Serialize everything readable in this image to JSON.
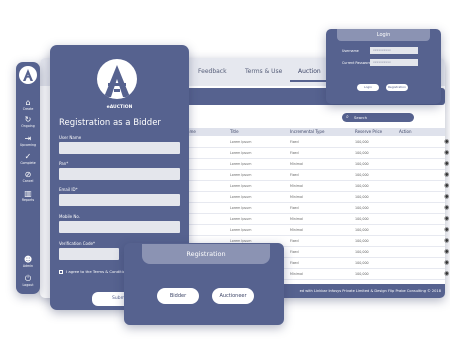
{
  "colors": {
    "primary": "#56628f",
    "accent": "#8b93b3",
    "tab_bg": "#e6e8ef"
  },
  "sidebar": {
    "logo_icon": "auction-logo-icon",
    "items": [
      {
        "label": "Create",
        "icon": "house-icon"
      },
      {
        "label": "Ongoing",
        "icon": "refresh-icon"
      },
      {
        "label": "Upcoming",
        "icon": "forward-icon"
      },
      {
        "label": "Complete",
        "icon": "check-icon"
      },
      {
        "label": "Cancel",
        "icon": "ban-icon"
      },
      {
        "label": "Reports",
        "icon": "bar-chart-icon"
      },
      {
        "label": "Admin",
        "icon": "user-icon"
      },
      {
        "label": "Logout",
        "icon": "power-icon"
      }
    ]
  },
  "main": {
    "tabs": [
      "Feedback",
      "Terms & Use",
      "Auction"
    ],
    "search_placeholder": "Search",
    "columns": [
      "Name",
      "Title",
      "Incremental Type",
      "Reserve Price",
      "Action"
    ],
    "rows": [
      {
        "title": "Lorem Ipsum",
        "type": "Fixed",
        "price": "100,000"
      },
      {
        "title": "Lorem Ipsum",
        "type": "Fixed",
        "price": "100,000"
      },
      {
        "title": "Lorem Ipsum",
        "type": "Minimal",
        "price": "100,000"
      },
      {
        "title": "Lorem Ipsum",
        "type": "Fixed",
        "price": "100,000"
      },
      {
        "title": "Lorem Ipsum",
        "type": "Minimal",
        "price": "100,000"
      },
      {
        "title": "Lorem Ipsum",
        "type": "Minimal",
        "price": "100,000"
      },
      {
        "title": "Lorem Ipsum",
        "type": "Fixed",
        "price": "100,000"
      },
      {
        "title": "Lorem Ipsum",
        "type": "Minimal",
        "price": "100,000"
      },
      {
        "title": "Lorem Ipsum",
        "type": "Minimal",
        "price": "100,000"
      },
      {
        "title": "Lorem Ipsum",
        "type": "Fixed",
        "price": "100,000"
      },
      {
        "title": "Lorem Ipsum",
        "type": "Fixed",
        "price": "100,000"
      },
      {
        "title": "Lorem Ipsum",
        "type": "Fixed",
        "price": "100,000"
      },
      {
        "title": "Lorem Ipsum",
        "type": "Minimal",
        "price": "100,000"
      }
    ],
    "footer": "ed with Linkbar Infosys Private Limited & Design Flip Prabe Consulting © 2018"
  },
  "registration": {
    "logo_text": "eAUCTION",
    "title": "Registration as a Bidder",
    "fields": [
      "User Name",
      "Pan*",
      "Email ID*",
      "Mobile No.",
      "Verification Code*"
    ],
    "agree_text": "I agree to the Terms & Conditions a",
    "submit_label": "Submit"
  },
  "login": {
    "title": "Login",
    "username_label": "Username",
    "username_value": "xxxxxxxxxx",
    "password_label": "Current Password",
    "password_value": "xxxxxxxxxx",
    "login_button": "Login",
    "register_button": "Registration"
  },
  "registration_type": {
    "title": "Registration",
    "bidder_button": "Bidder",
    "auctioneer_button": "Auctioneer"
  }
}
